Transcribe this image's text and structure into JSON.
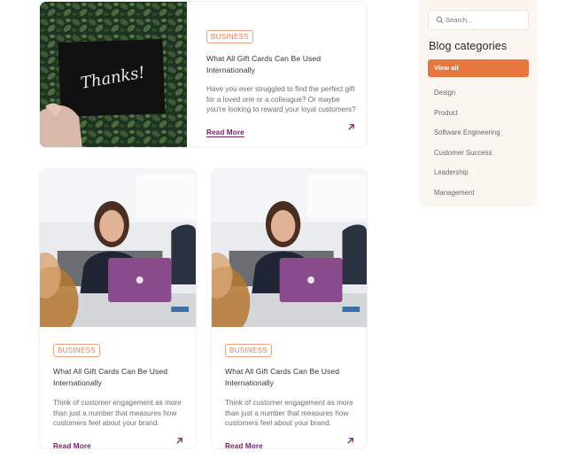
{
  "posts": [
    {
      "badge": "BUSINESS",
      "title": "What All Gift Cards Can Be Used Internationally",
      "excerpt": "Have you ever struggled to find the perfect gift for a loved one or a colleague? Or maybe you're looking to reward your loyal customers?",
      "read_more": "Read More",
      "image": {
        "card_text": "Thanks!"
      }
    },
    {
      "badge": "BUSINESS",
      "title": "What All Gift Cards Can Be Used Internationally",
      "excerpt": "Think of customer engagement as more than just a number that measures how customers feel about your brand.",
      "read_more": "Read More"
    },
    {
      "badge": "BUSINESS",
      "title": "What All Gift Cards Can Be Used Internationally",
      "excerpt": "Think of customer engagement as more than just a number that measures how customers feel about your brand.",
      "read_more": "Read More"
    }
  ],
  "sidebar": {
    "search_placeholder": "Search...",
    "title": "Blog categories",
    "view_all": "View all",
    "categories": [
      "Design",
      "Product",
      "Software Engineering",
      "Customer Success",
      "Leadership",
      "Management"
    ]
  },
  "colors": {
    "accent": "#e8773f",
    "link": "#7b1c6d",
    "sidebar_bg": "#fcf6f1",
    "badge": "#e2845b"
  },
  "icons": [
    "search-icon",
    "arrow-up-right-icon"
  ]
}
